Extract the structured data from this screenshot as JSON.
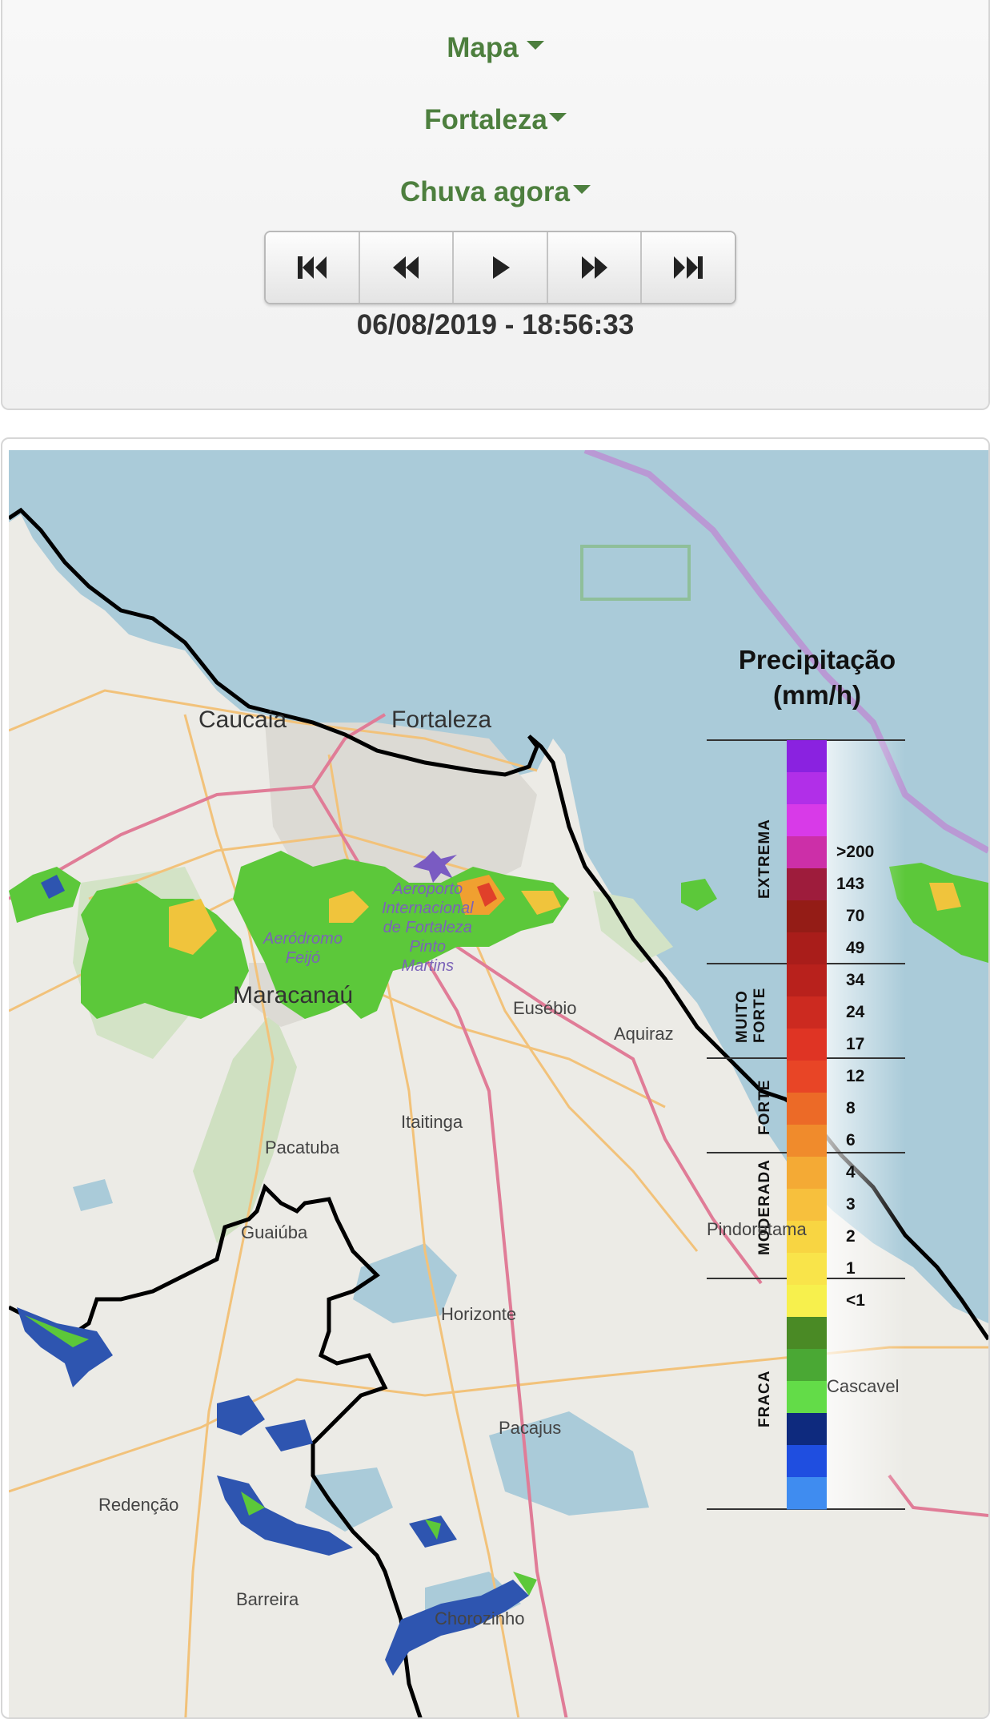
{
  "controls": {
    "view_dropdown": "Mapa",
    "city_dropdown": "Fortaleza",
    "layer_dropdown": "Chuva agora",
    "player_buttons": [
      "first-icon",
      "rewind-icon",
      "play-icon",
      "fast-forward-icon",
      "last-icon"
    ],
    "timestamp": "06/08/2019 - 18:56:33"
  },
  "legend": {
    "title_line1": "Precipitação",
    "title_line2": "(mm/h)",
    "categories": [
      "EXTREMA",
      "MUITO FORTE",
      "FORTE",
      "MODERADA",
      "FRACA"
    ],
    "values": [
      ">200",
      "143",
      "70",
      "49",
      "34",
      "24",
      "17",
      "12",
      "8",
      "6",
      "4",
      "3",
      "2",
      "1",
      "<1"
    ],
    "colors": [
      "#8a22e0",
      "#b12fe8",
      "#d83ae8",
      "#cc2fa8",
      "#9e1c3c",
      "#941c16",
      "#a91d1a",
      "#b8211c",
      "#cc2a20",
      "#df3424",
      "#e84526",
      "#ec6a27",
      "#f08b2c",
      "#f4aa35",
      "#f7c03d",
      "#f8d542",
      "#f9e44a",
      "#f7f04d",
      "#4a8a25",
      "#4aa834",
      "#63dc48",
      "#0e2a7e",
      "#1f4ee0",
      "#3f8cf0"
    ]
  },
  "places": {
    "caucaia": "Caucaia",
    "fortaleza": "Fortaleza",
    "maracanau": "Maracanaú",
    "eusebio": "Eusébio",
    "aquiraz": "Aquiraz",
    "itaitinga": "Itaitinga",
    "pacatuba": "Pacatuba",
    "guaiuba": "Guaiúba",
    "horizonte": "Horizonte",
    "pacajus": "Pacajus",
    "redencao": "Redenção",
    "barreira": "Barreira",
    "chorozinho": "Chorozinho",
    "cascavel": "Cascavel",
    "pindoretama": "Pindoretama",
    "airport_line1": "Aeroporto",
    "airport_line2": "Internacional",
    "airport_line3": "de Fortaleza",
    "airport_line4": "Pinto",
    "airport_line5": "Martins",
    "aerodromo_line1": "Aeródromo",
    "aerodromo_line2": "Feijó"
  }
}
